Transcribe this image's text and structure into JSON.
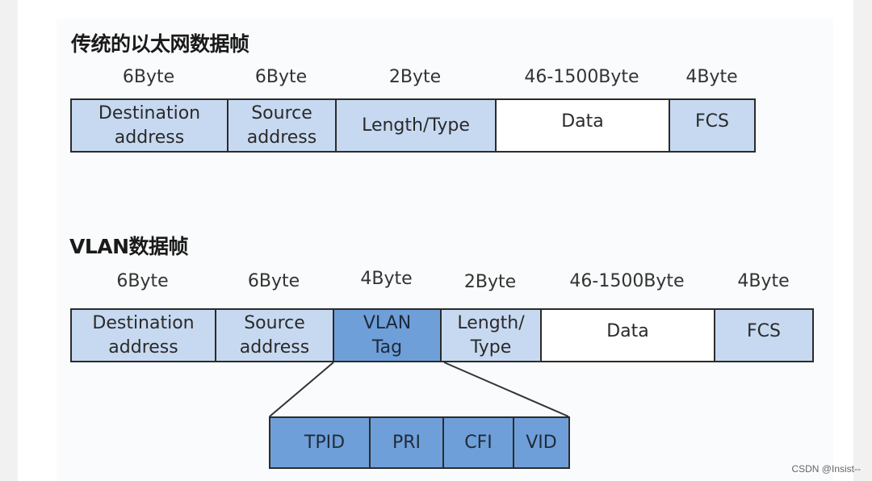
{
  "traditional": {
    "title": "传统的以太网数据帧",
    "fields": [
      {
        "size": "6Byte",
        "label": "Destination address",
        "line1": "Destination",
        "line2": "address",
        "fill": "light"
      },
      {
        "size": "6Byte",
        "label": "Source address",
        "line1": "Source",
        "line2": "address",
        "fill": "light"
      },
      {
        "size": "2Byte",
        "label": "Length/Type",
        "line1": "Length/Type",
        "line2": "",
        "fill": "light"
      },
      {
        "size": "46-1500Byte",
        "label": "Data",
        "line1": "Data",
        "line2": "",
        "fill": "white"
      },
      {
        "size": "4Byte",
        "label": "FCS",
        "line1": "FCS",
        "line2": "",
        "fill": "light"
      }
    ]
  },
  "vlan": {
    "title": "VLAN数据帧",
    "fields": [
      {
        "size": "6Byte",
        "label": "Destination address",
        "line1": "Destination",
        "line2": "address",
        "fill": "light"
      },
      {
        "size": "6Byte",
        "label": "Source address",
        "line1": "Source",
        "line2": "address",
        "fill": "light"
      },
      {
        "size": "4Byte",
        "label": "VLAN Tag",
        "line1": "VLAN",
        "line2": "Tag",
        "fill": "dark"
      },
      {
        "size": "2Byte",
        "label": "Length/Type",
        "line1": "Length/",
        "line2": "Type",
        "fill": "light"
      },
      {
        "size": "46-1500Byte",
        "label": "Data",
        "line1": "Data",
        "line2": "",
        "fill": "white"
      },
      {
        "size": "4Byte",
        "label": "FCS",
        "line1": "FCS",
        "line2": "",
        "fill": "light"
      }
    ],
    "tag_fields": [
      "TPID",
      "PRI",
      "CFI",
      "VID"
    ]
  },
  "colors": {
    "light_field": "#c7d9f1",
    "dark_field": "#6f9fd8",
    "white_field": "#ffffff",
    "border": "#2b2b2b"
  },
  "watermark": "CSDN @Insist--"
}
